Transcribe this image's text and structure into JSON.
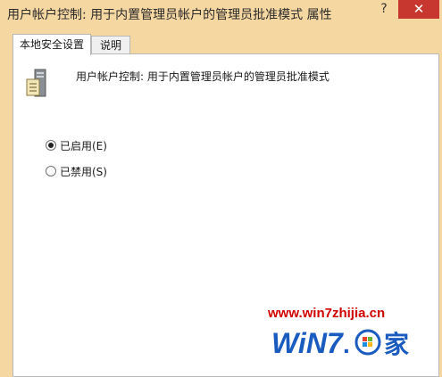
{
  "window": {
    "title": "用户帐户控制: 用于内置管理员帐户的管理员批准模式 属性",
    "help_label": "?",
    "close_label": "✕"
  },
  "tabs": [
    {
      "label": "本地安全设置",
      "active": true
    },
    {
      "label": "说明",
      "active": false
    }
  ],
  "policy": {
    "icon": "server-policy-icon",
    "title": "用户帐户控制: 用于内置管理员帐户的管理员批准模式"
  },
  "options": [
    {
      "label": "已启用(E)",
      "selected": true
    },
    {
      "label": "已禁用(S)",
      "selected": false
    }
  ],
  "watermark": {
    "url": "www.win7zhijia.cn",
    "logo_text": "WiN7",
    "logo_suffix": "家"
  },
  "colors": {
    "titlebar": "#f5d7a2",
    "close": "#c7372f",
    "watermark_red": "#d10000",
    "watermark_blue": "#1a5bbf"
  }
}
